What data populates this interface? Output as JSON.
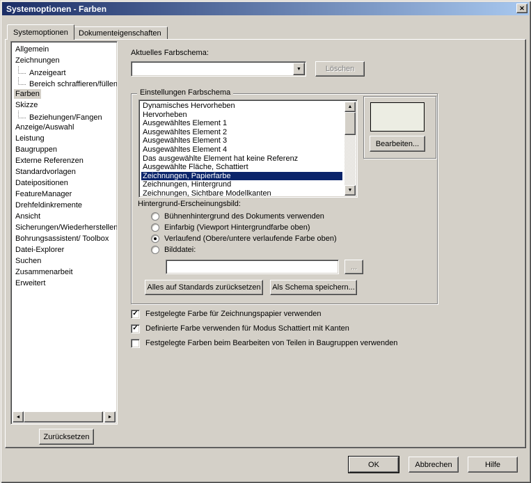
{
  "window": {
    "title": "Systemoptionen - Farben"
  },
  "icons": {
    "close": "✕",
    "combo_arrow": "▼",
    "scroll_up": "▲",
    "scroll_down": "▼",
    "scroll_left": "◄",
    "scroll_right": "►"
  },
  "tabs": [
    {
      "label": "Systemoptionen",
      "active": true
    },
    {
      "label": "Dokumenteigenschaften",
      "active": false
    }
  ],
  "sidebar": {
    "items": [
      {
        "label": "Allgemein"
      },
      {
        "label": "Zeichnungen"
      },
      {
        "label": "Anzeigeart",
        "child": true
      },
      {
        "label": "Bereich schraffieren/füllen",
        "child": true
      },
      {
        "label": "Farben",
        "selected": true
      },
      {
        "label": "Skizze"
      },
      {
        "label": "Beziehungen/Fangen",
        "child": true
      },
      {
        "label": "Anzeige/Auswahl"
      },
      {
        "label": "Leistung"
      },
      {
        "label": "Baugruppen"
      },
      {
        "label": "Externe Referenzen"
      },
      {
        "label": "Standardvorlagen"
      },
      {
        "label": "Dateipositionen"
      },
      {
        "label": "FeatureManager"
      },
      {
        "label": "Drehfeldinkremente"
      },
      {
        "label": "Ansicht"
      },
      {
        "label": "Sicherungen/Wiederherstellen"
      },
      {
        "label": "Bohrungsassistent/ Toolbox"
      },
      {
        "label": "Datei-Explorer"
      },
      {
        "label": "Suchen"
      },
      {
        "label": "Zusammenarbeit"
      },
      {
        "label": "Erweitert"
      }
    ],
    "reset_label": "Zurücksetzen"
  },
  "content": {
    "scheme_label": "Aktuelles Farbschema:",
    "scheme_value": "",
    "delete_label": "Löschen",
    "group_label": "Einstellungen Farbschema",
    "color_items": [
      {
        "label": "Dynamisches Hervorheben"
      },
      {
        "label": "Hervorheben"
      },
      {
        "label": "Ausgewähltes Element 1"
      },
      {
        "label": "Ausgewähltes Element 2"
      },
      {
        "label": "Ausgewähltes Element 3"
      },
      {
        "label": "Ausgewähltes Element 4"
      },
      {
        "label": "Das ausgewählte Element hat keine Referenz"
      },
      {
        "label": "Ausgewählte Fläche, Schattiert"
      },
      {
        "label": "Zeichnungen, Papierfarbe",
        "selected": true
      },
      {
        "label": "Zeichnungen, Hintergrund"
      },
      {
        "label": "Zeichnungen, Sichtbare Modellkanten"
      }
    ],
    "edit_label": "Bearbeiten...",
    "background_label": "Hintergrund-Erscheinungsbild:",
    "radios": [
      {
        "label": "Bühnenhintergrund des Dokuments verwenden",
        "selected": false
      },
      {
        "label": "Einfarbig (Viewport Hintergrundfarbe oben)",
        "selected": false
      },
      {
        "label": "Verlaufend (Obere/untere verlaufende Farbe oben)",
        "selected": true
      },
      {
        "label": "Bilddatei:",
        "selected": false
      }
    ],
    "image_file_value": "",
    "browse_label": "...",
    "reset_standards_label": "Alles auf Standards zurücksetzen",
    "save_scheme_label": "Als Schema speichern...",
    "checkboxes": [
      {
        "label": "Festgelegte Farbe für Zeichnungspapier verwenden",
        "checked": true
      },
      {
        "label": "Definierte Farbe verwenden für Modus Schattiert mit Kanten",
        "checked": true
      },
      {
        "label": "Festgelegte Farben beim Bearbeiten von Teilen in Baugruppen verwenden",
        "checked": false
      }
    ]
  },
  "footer": {
    "ok_label": "OK",
    "cancel_label": "Abbrechen",
    "help_label": "Hilfe"
  },
  "colors": {
    "dialog_bg": "#d4d0c8",
    "titlebar_start": "#1c2e66",
    "titlebar_end": "#a8c8ef",
    "selection": "#0a246a",
    "swatch": "#ecede3"
  }
}
